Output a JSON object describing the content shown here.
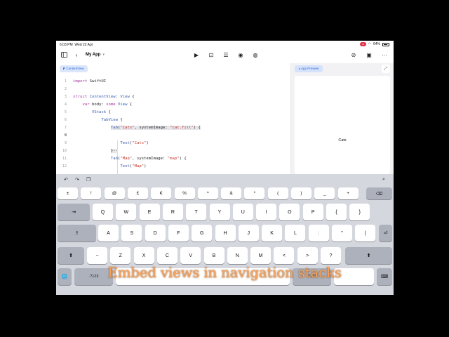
{
  "status_bar": {
    "time": "6:03 PM",
    "date": "Wed 22 Apr",
    "record_label": "●",
    "battery": "64%"
  },
  "toolbar": {
    "app_title": "My App",
    "left_icons": [
      "sidebar-icon",
      "back-chevron-icon"
    ],
    "center_icons": [
      "play-icon",
      "stop-icon",
      "sliders-icon",
      "record-icon",
      "palette-icon"
    ],
    "right_icons": [
      "compass-icon",
      "library-icon",
      "more-icon"
    ]
  },
  "editor": {
    "file_tab": "ContentView",
    "lines": [
      {
        "n": "1",
        "text": "import SwiftUI"
      },
      {
        "n": "2",
        "text": ""
      },
      {
        "n": "3",
        "text": "struct ContentView: View {"
      },
      {
        "n": "4",
        "text": "    var body: some View {"
      },
      {
        "n": "5",
        "text": "        VStack {"
      },
      {
        "n": "6",
        "text": "            TabView {"
      },
      {
        "n": "7",
        "text": "                Tab(\"Cats\", systemImage: \"cat.fill\") {"
      },
      {
        "n": "8",
        "text": ""
      },
      {
        "n": "9",
        "text": "                    Text(\"Cats\")"
      },
      {
        "n": "10",
        "text": "                }··"
      },
      {
        "n": "11",
        "text": "                Tab(\"Map\", systemImage: \"map\") {"
      },
      {
        "n": "12",
        "text": "                    Text(\"Map\")"
      }
    ]
  },
  "preview": {
    "tab_label": "App Preview",
    "content_label": "Cats"
  },
  "keyboard": {
    "shortcuts": [
      "undo-icon",
      "redo-icon",
      "paste-icon"
    ],
    "symbol_row": [
      "±",
      "!",
      "@",
      "£",
      "€",
      "%",
      "^",
      "&",
      "*",
      "(",
      ")",
      "_",
      "+"
    ],
    "qwerty_row": [
      "Q",
      "W",
      "E",
      "R",
      "T",
      "Y",
      "U",
      "I",
      "O",
      "P",
      "{",
      "}"
    ],
    "home_row": [
      "A",
      "S",
      "D",
      "F",
      "G",
      "H",
      "J",
      "K",
      "L",
      ":",
      "\"",
      "|"
    ],
    "bottom_row": [
      "~",
      "Z",
      "X",
      "C",
      "V",
      "B",
      "N",
      "M",
      "<",
      ">",
      "?"
    ],
    "numbers_label": ".?123"
  },
  "caption": "Embed views in navigation stacks"
}
